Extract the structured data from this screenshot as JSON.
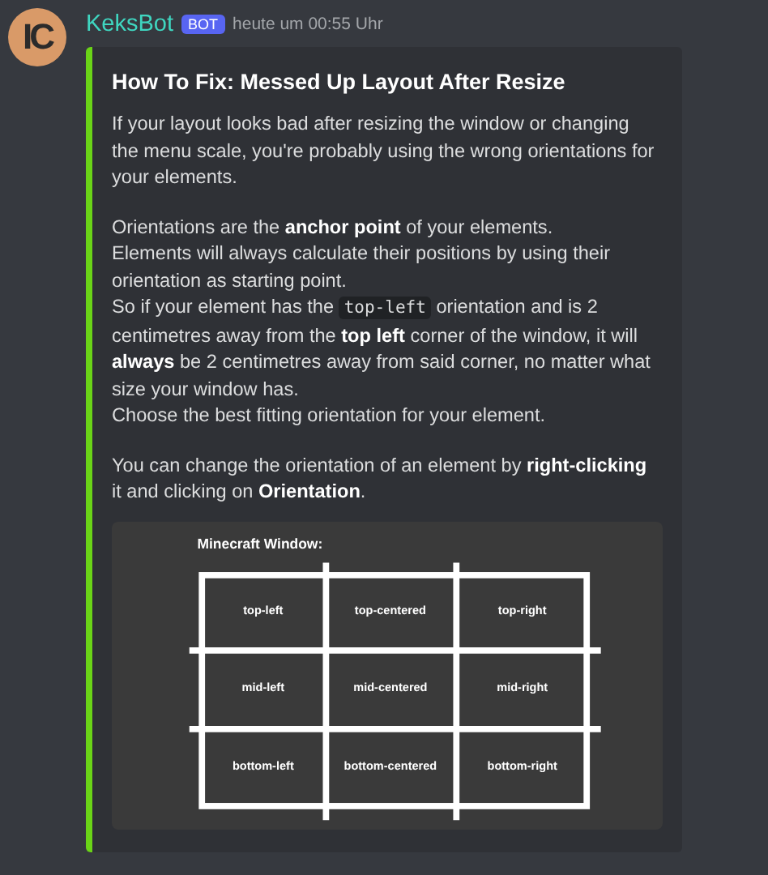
{
  "message": {
    "avatar_text": "IC",
    "author": "KeksBot",
    "tag": "BOT",
    "timestamp": "heute um 00:55 Uhr"
  },
  "embed": {
    "title": "How To Fix: Messed Up Layout After Resize",
    "blocks": [
      [
        [
          {
            "text": "If your layout looks bad after resizing the window or changing the menu scale, you're probably using the wrong orientations for your elements."
          }
        ]
      ],
      [
        [
          {
            "text": "Orientations are the **anchor point** of your elements."
          }
        ],
        [
          {
            "text": "Elements will always calculate their positions by using their orientation as starting point."
          }
        ],
        [
          {
            "text": "So if your element has the "
          },
          {
            "kind": "code",
            "text": "top-left"
          },
          {
            "text": " orientation and is 2 centimetres away from the **top left** corner of the window, it will **always** be 2 centimetres away from said corner, no matter what size your window has."
          }
        ],
        [
          {
            "text": "Choose the best fitting orientation for your element."
          }
        ]
      ],
      [
        [
          {
            "text": "You can change the orientation of an element by **right-clicking** it and clicking on **Orientation**."
          }
        ]
      ]
    ],
    "diagram": {
      "title": "Minecraft Window:",
      "cells": [
        [
          "top-left",
          "top-centered",
          "top-right"
        ],
        [
          "mid-left",
          "mid-centered",
          "mid-right"
        ],
        [
          "bottom-left",
          "bottom-centered",
          "bottom-right"
        ]
      ]
    }
  }
}
